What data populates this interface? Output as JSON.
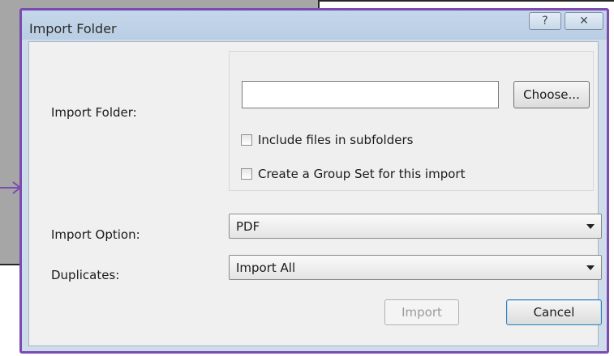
{
  "window": {
    "title": "Import Folder",
    "help_glyph": "?",
    "close_glyph": "✕"
  },
  "form": {
    "folder_label": "Import Folder:",
    "folder_value": "",
    "choose_label": "Choose...",
    "include_subfolders_label": "Include files in subfolders",
    "include_subfolders_checked": false,
    "group_set_label": "Create a Group Set for this import",
    "group_set_checked": false,
    "import_option_label": "Import Option:",
    "import_option_value": "PDF",
    "duplicates_label": "Duplicates:",
    "duplicates_value": "Import All"
  },
  "buttons": {
    "import_label": "Import",
    "cancel_label": "Cancel"
  },
  "colors": {
    "dialog_border": "#7a4bb0",
    "arrow": "#7a4bb0"
  },
  "icons": [
    "help-icon",
    "close-icon",
    "dropdown-arrow-icon",
    "callout-arrow-icon"
  ]
}
